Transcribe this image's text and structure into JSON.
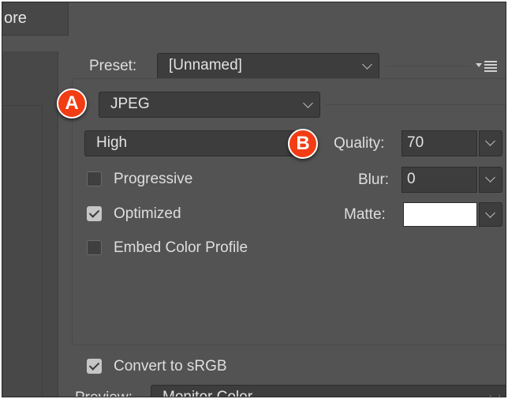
{
  "tab": {
    "label": "ore"
  },
  "preset": {
    "label": "Preset:",
    "value": "[Unnamed]"
  },
  "format": {
    "value": "JPEG"
  },
  "quality_preset": {
    "value": "High"
  },
  "quality": {
    "label": "Quality:",
    "value": "70"
  },
  "blur": {
    "label": "Blur:",
    "value": "0"
  },
  "matte": {
    "label": "Matte:",
    "color": "#ffffff"
  },
  "options": {
    "progressive": {
      "label": "Progressive",
      "checked": false
    },
    "optimized": {
      "label": "Optimized",
      "checked": true
    },
    "embed_profile": {
      "label": "Embed Color Profile",
      "checked": false
    },
    "convert_srgb": {
      "label": "Convert to sRGB",
      "checked": true
    }
  },
  "preview": {
    "label": "Preview:",
    "value": "Monitor Color"
  },
  "badges": {
    "a": "A",
    "b": "B"
  },
  "colors": {
    "panel": "#535353",
    "field": "#3d3d3d",
    "badge": "#f23c14"
  },
  "icons": {
    "panel_menu": "panel-menu-icon"
  }
}
